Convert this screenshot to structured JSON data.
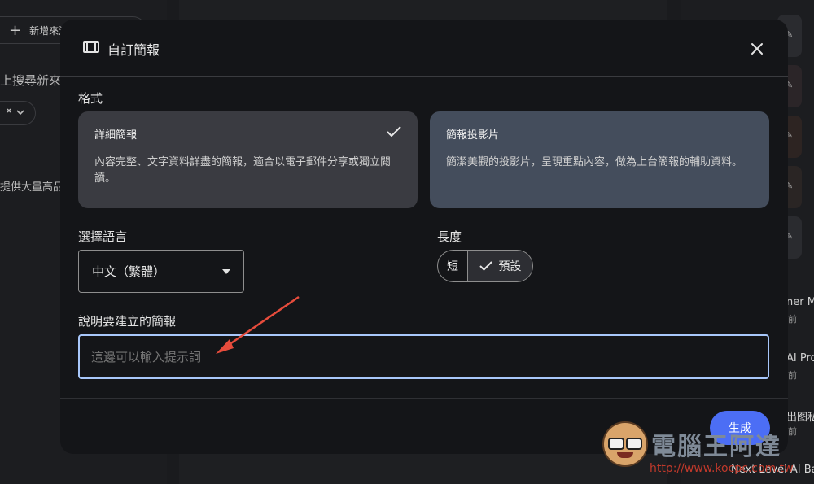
{
  "background": {
    "add_source_label": "新增來源",
    "search_text": "上搜尋新來",
    "chip_label": "⁺",
    "left_text": "提供大量高品",
    "right_items": [
      {
        "title": "ner M",
        "sub": "前"
      },
      {
        "title": "AI Pro",
        "sub": "前"
      },
      {
        "title": "出图私",
        "sub": "前"
      }
    ],
    "next_item_title": "Next Level AI Ba"
  },
  "modal": {
    "title": "自訂簡報",
    "format": {
      "label": "格式",
      "options": [
        {
          "title": "詳細簡報",
          "desc": "內容完整、文字資料詳盡的簡報，適合以電子郵件分享或獨立閱讀。",
          "selected": true
        },
        {
          "title": "簡報投影片",
          "desc": "簡潔美觀的投影片，呈現重點內容，做為上台簡報的輔助資料。",
          "selected": false
        }
      ]
    },
    "language": {
      "label": "選擇語言",
      "value": "中文（繁體）"
    },
    "length": {
      "label": "長度",
      "options": [
        "短",
        "預設"
      ],
      "selected": "預設"
    },
    "prompt": {
      "label": "說明要建立的簡報",
      "placeholder": "這邊可以輸入提示詞"
    },
    "generate_label": "生成"
  },
  "watermark": {
    "title": "電腦王阿達",
    "url": "http://www.kocpc.com.tw"
  },
  "colors": {
    "accent": "#4c6ef5",
    "input_focus": "#a8c7fa",
    "annotation_arrow": "#e74c3c"
  }
}
